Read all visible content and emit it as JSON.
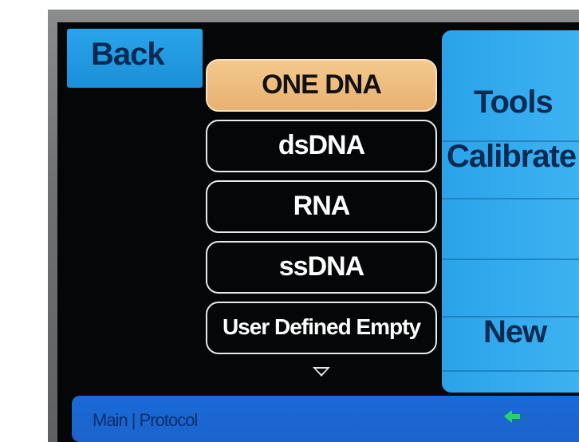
{
  "header": {
    "back_label": "Back"
  },
  "protocols": [
    {
      "label": "ONE DNA",
      "selected": true
    },
    {
      "label": "dsDNA",
      "selected": false
    },
    {
      "label": "RNA",
      "selected": false
    },
    {
      "label": "ssDNA",
      "selected": false
    },
    {
      "label": "User Defined Empty",
      "selected": false
    }
  ],
  "side_menu": {
    "tools_label": "Tools",
    "calibrate_label": "Calibrate",
    "new_label": "New"
  },
  "status_bar": {
    "breadcrumb": "Main | Protocol",
    "icon": "back-arrow-icon"
  },
  "colors": {
    "accent_blue": "#2aa3ea",
    "selected_item": "#f4c98d",
    "status_blue": "#1a6ad6",
    "screen_bg": "#040607"
  }
}
